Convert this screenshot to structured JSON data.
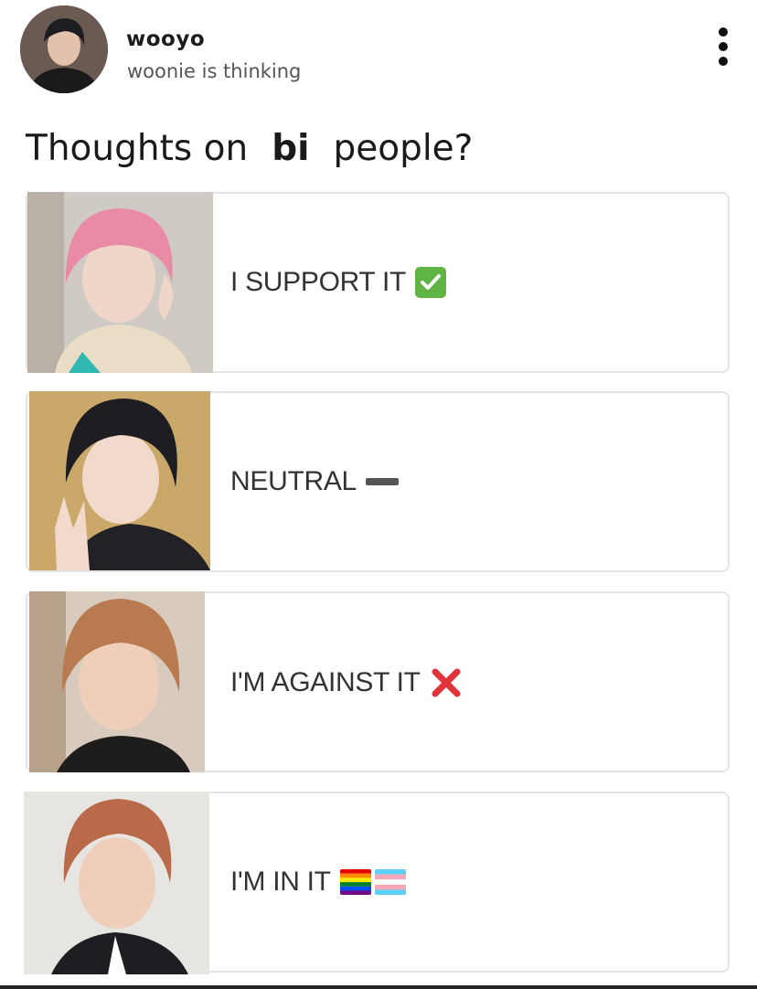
{
  "header": {
    "username": "wooyo",
    "status": "woonie is thinking"
  },
  "question": {
    "before": "Thoughts on",
    "emphasis": "bi",
    "after": "people?"
  },
  "options": [
    {
      "label": "I SUPPORT IT",
      "emoji": "check-mark-button-icon"
    },
    {
      "label": "NEUTRAL",
      "emoji": "minus-icon"
    },
    {
      "label": "I'M AGAINST IT",
      "emoji": "cross-mark-icon"
    },
    {
      "label": "I'M IN IT",
      "emoji": "rainbow-flag-icon, transgender-flag-icon"
    }
  ],
  "colors": {
    "check_green": "#5fb444",
    "cross_red": "#e0333a",
    "border": "#e4e4e4"
  }
}
